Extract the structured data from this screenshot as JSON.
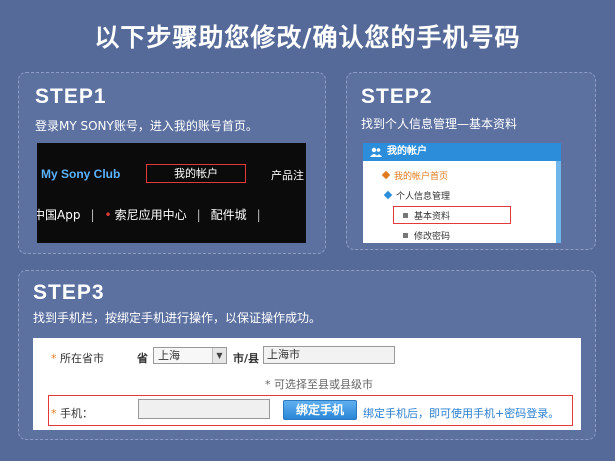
{
  "title": "以下步骤助您修改/确认您的手机号码",
  "step1": {
    "heading": "STEP1",
    "desc": "登录MY SONY账号，进入我的账号首页。",
    "nav": {
      "brand": "My Sony Club",
      "account": "我的帐户",
      "products": "产品注",
      "links": [
        "中国App",
        "索尼应用中心",
        "配件城"
      ]
    }
  },
  "step2": {
    "heading": "STEP2",
    "desc": "找到个人信息管理—基本资料",
    "menu": {
      "header": "我的帐户",
      "home": "我的帐户首页",
      "personal": "个人信息管理",
      "basic": "基本资料",
      "password": "修改密码"
    }
  },
  "step3": {
    "heading": "STEP3",
    "desc": "找到手机栏，按绑定手机进行操作，以保证操作成功。",
    "form": {
      "location_label": "所在省市",
      "province_label": "省",
      "province_value": "上海",
      "city_label": "市/县",
      "city_value": "上海市",
      "hint": "* 可选择至县或县级市",
      "phone_label": "手机：",
      "phone_value": "",
      "bind_button": "绑定手机",
      "bind_tip": "绑定手机后，即可使用手机+密码登录。"
    }
  },
  "colors": {
    "background": "#566a9a",
    "highlight_box": "#e23a3a",
    "link_blue": "#2a7fd0",
    "brand_blue": "#5bb2ff"
  }
}
